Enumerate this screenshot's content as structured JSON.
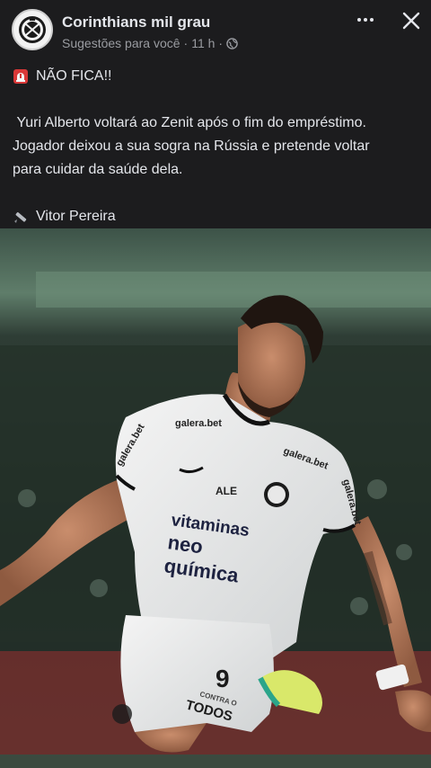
{
  "post": {
    "page_name": "Corinthians mil grau",
    "subtitle": "Sugestões para você",
    "time": "11 h",
    "headline": "NÃO FICA!!",
    "body_line1": "Yuri Alberto voltará ao Zenit após o fim do empréstimo.",
    "body_line2": "Jogador deixou a sua sogra na Rússia e pretende voltar",
    "body_line3": "para cuidar da saúde dela.",
    "author": "Vitor Pereira"
  },
  "photo": {
    "shirt_sponsor_top": "galera.bet",
    "shirt_sponsor_chest": "galera.bet",
    "shirt_sponsor_main_1": "vitaminas",
    "shirt_sponsor_main_2": "neo",
    "shirt_sponsor_main_3": "química",
    "sleeve_left": "galera.bet",
    "sleeve_right": "galera.bet",
    "shorts_number": "9",
    "shorts_text": "TODOS",
    "shorts_small": "CONTRA O"
  },
  "icons": {
    "siren": "police-light-icon",
    "pen": "pen-icon",
    "globe": "globe-icon",
    "more": "more-options-icon",
    "close": "close-icon"
  },
  "colors": {
    "background": "#1c1c1e",
    "text": "#e4e6eb",
    "muted": "#9a9ca1"
  }
}
